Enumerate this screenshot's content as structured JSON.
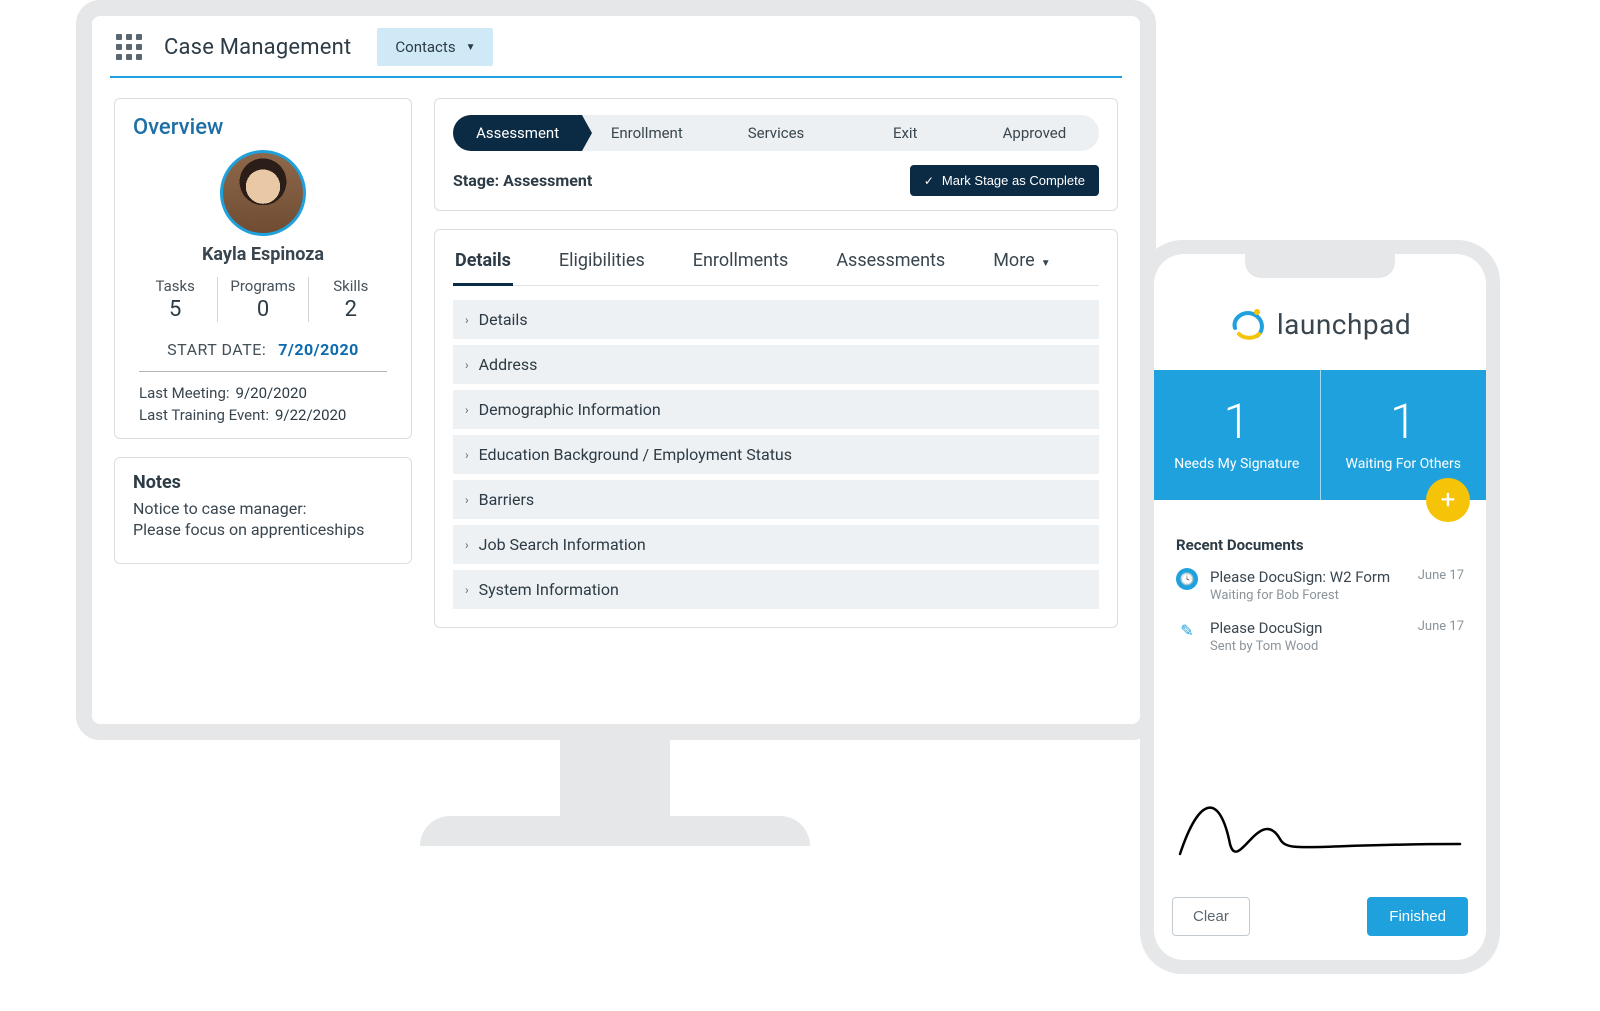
{
  "header": {
    "app_title": "Case Management",
    "nav_tab": "Contacts"
  },
  "overview": {
    "title": "Overview",
    "person_name": "Kayla Espinoza",
    "stats": [
      {
        "label": "Tasks",
        "value": "5"
      },
      {
        "label": "Programs",
        "value": "0"
      },
      {
        "label": "Skills",
        "value": "2"
      }
    ],
    "start_date_label": "START DATE:",
    "start_date_value": "7/20/2020",
    "last_meeting_label": "Last Meeting:",
    "last_meeting_value": "9/20/2020",
    "last_training_label": "Last Training Event:",
    "last_training_value": "9/22/2020"
  },
  "notes": {
    "title": "Notes",
    "line1": "Notice to case manager:",
    "line2": "Please focus on apprenticeships"
  },
  "path": {
    "steps": [
      "Assessment",
      "Enrollment",
      "Services",
      "Exit",
      "Approved"
    ],
    "active_index": 0,
    "stage_label": "Stage:",
    "stage_value": "Assessment",
    "mark_button": "Mark Stage as Complete"
  },
  "tabs": {
    "items": [
      "Details",
      "Eligibilities",
      "Enrollments",
      "Assessments",
      "More"
    ],
    "active_index": 0
  },
  "accordion": [
    "Details",
    "Address",
    "Demographic Information",
    "Education Background / Employment Status",
    "Barriers",
    "Job Search Information",
    "System Information"
  ],
  "phone": {
    "brand": "launchpad",
    "tiles": [
      {
        "count": "1",
        "caption": "Needs My Signature"
      },
      {
        "count": "1",
        "caption": "Waiting For Others"
      }
    ],
    "recent_title": "Recent Documents",
    "docs": [
      {
        "icon": "clock",
        "title": "Please DocuSign: W2 Form",
        "sub": "Waiting for Bob Forest",
        "date": "June 17"
      },
      {
        "icon": "pen",
        "title": "Please DocuSign",
        "sub": "Sent by Tom Wood",
        "date": "June 17"
      }
    ],
    "clear": "Clear",
    "finished": "Finished"
  }
}
